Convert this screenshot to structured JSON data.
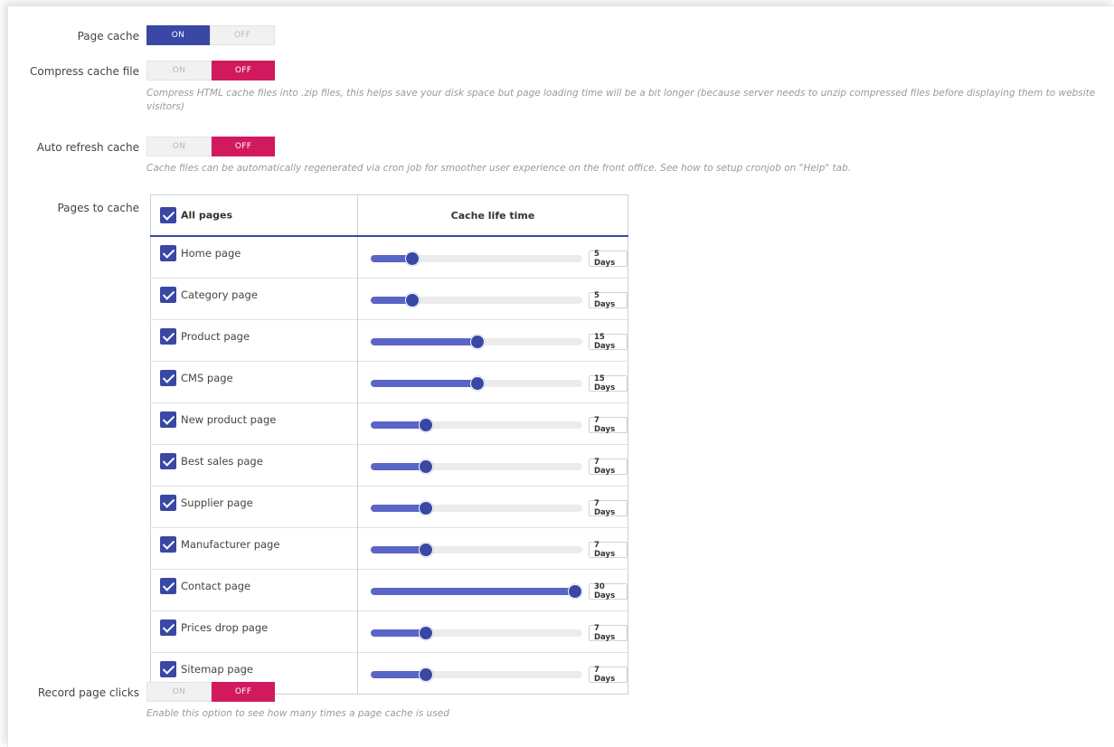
{
  "settings": {
    "page_cache": {
      "label": "Page cache",
      "on": "ON",
      "off": "OFF",
      "value": "ON"
    },
    "compress": {
      "label": "Compress cache file",
      "on": "ON",
      "off": "OFF",
      "value": "OFF",
      "help": "Compress HTML cache files into .zip files, this helps save your disk space but page loading time will be a bit longer (because server needs to unzip compressed files before displaying them to website visitors)"
    },
    "auto_refresh": {
      "label": "Auto refresh cache",
      "on": "ON",
      "off": "OFF",
      "value": "OFF",
      "help": "Cache files can be automatically regenerated via cron job for smoother user experience on the front office. See how to setup cronjob on \"Help\" tab."
    },
    "record_clicks": {
      "label": "Record page clicks",
      "on": "ON",
      "off": "OFF",
      "value": "OFF",
      "help": "Enable this option to see how many times a page cache is used"
    }
  },
  "pages_to_cache": {
    "label": "Pages to cache",
    "all_pages_label": "All pages",
    "lifetime_header": "Cache life time",
    "slider_max_days": 30,
    "rows": [
      {
        "name": "Home page",
        "checked": true,
        "days": 5,
        "days_label": "5 Days"
      },
      {
        "name": "Category page",
        "checked": true,
        "days": 5,
        "days_label": "5 Days"
      },
      {
        "name": "Product page",
        "checked": true,
        "days": 15,
        "days_label": "15 Days"
      },
      {
        "name": "CMS page",
        "checked": true,
        "days": 15,
        "days_label": "15 Days"
      },
      {
        "name": "New product page",
        "checked": true,
        "days": 7,
        "days_label": "7 Days"
      },
      {
        "name": "Best sales page",
        "checked": true,
        "days": 7,
        "days_label": "7 Days"
      },
      {
        "name": "Supplier page",
        "checked": true,
        "days": 7,
        "days_label": "7 Days"
      },
      {
        "name": "Manufacturer page",
        "checked": true,
        "days": 7,
        "days_label": "7 Days"
      },
      {
        "name": "Contact page",
        "checked": true,
        "days": 30,
        "days_label": "30 Days"
      },
      {
        "name": "Prices drop page",
        "checked": true,
        "days": 7,
        "days_label": "7 Days"
      },
      {
        "name": "Sitemap page",
        "checked": true,
        "days": 7,
        "days_label": "7 Days"
      }
    ]
  },
  "colors": {
    "accent": "#3948a4",
    "off_active": "#d11a5e",
    "slider_fill": "#5a65c8"
  },
  "icons": {
    "checkbox": "checkmark-icon"
  }
}
